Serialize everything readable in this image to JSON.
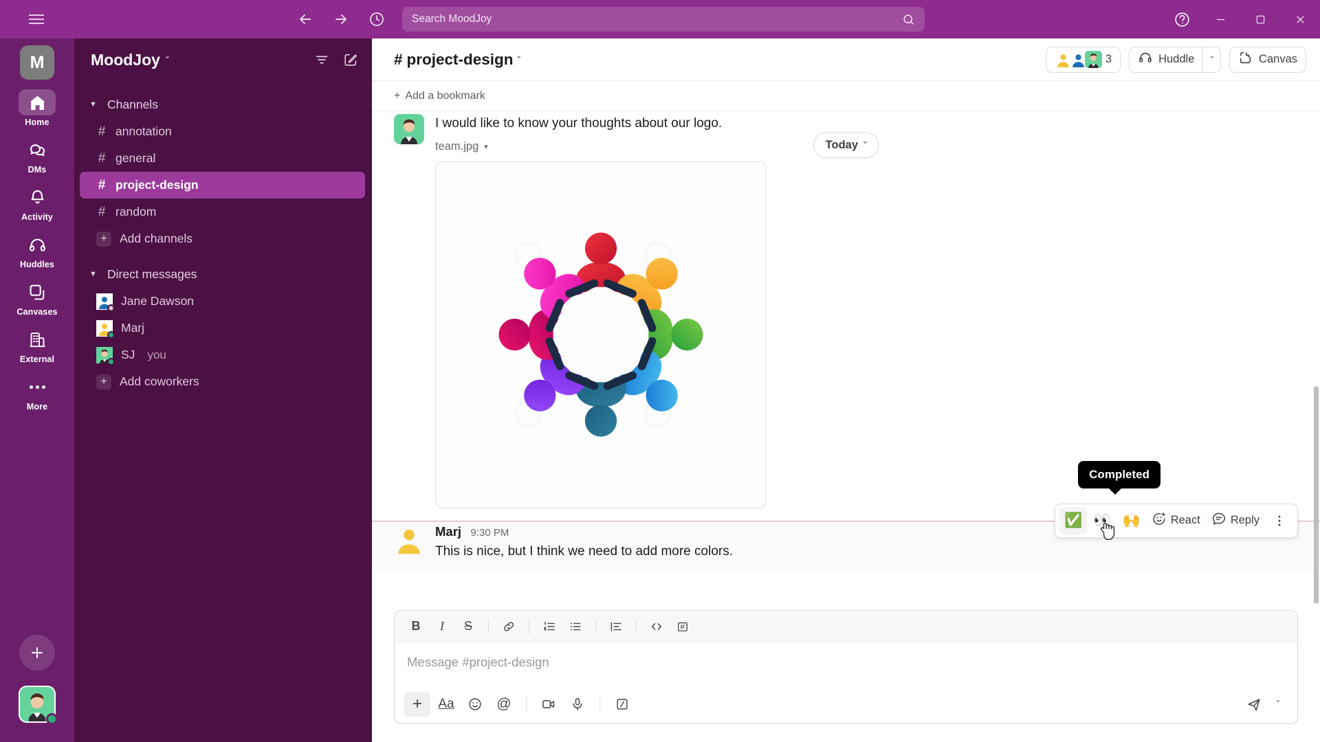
{
  "topbar": {
    "menu_icon": "hamburger-icon",
    "back_icon": "arrow-left-icon",
    "forward_icon": "arrow-right-icon",
    "history_icon": "clock-icon",
    "search_placeholder": "Search MoodJoy",
    "search_icon": "search-icon",
    "help_icon": "help-circle-icon",
    "minimize_label": "–",
    "maximize_label": "□",
    "close_label": "✕"
  },
  "rail": {
    "workspace_initial": "M",
    "items": [
      {
        "label": "Home",
        "icon": "home-icon",
        "active": true
      },
      {
        "label": "DMs",
        "icon": "dms-icon",
        "active": false
      },
      {
        "label": "Activity",
        "icon": "bell-icon",
        "active": false
      },
      {
        "label": "Huddles",
        "icon": "headphones-icon",
        "active": false
      },
      {
        "label": "Canvases",
        "icon": "canvas-icon",
        "active": false
      },
      {
        "label": "External",
        "icon": "building-icon",
        "active": false
      },
      {
        "label": "More",
        "icon": "ellipsis-icon",
        "active": false
      }
    ],
    "new_button_icon": "plus-icon",
    "avatar_name": "user-avatar"
  },
  "sidebar": {
    "workspace_name": "MoodJoy",
    "workspace_chevron": "ˇ",
    "filter_icon": "filter-icon",
    "compose_icon": "compose-icon",
    "channels_section": {
      "label": "Channels",
      "caret": "▼"
    },
    "channels": [
      {
        "label": "annotation",
        "prefix": "#",
        "active": false
      },
      {
        "label": "general",
        "prefix": "#",
        "active": false
      },
      {
        "label": "project-design",
        "prefix": "#",
        "active": true
      },
      {
        "label": "random",
        "prefix": "#",
        "active": false
      }
    ],
    "add_channels": {
      "label": "Add channels",
      "prefix": "+"
    },
    "dm_section": {
      "label": "Direct messages",
      "caret": "▼"
    },
    "dms": [
      {
        "label": "Jane Dawson",
        "presence": "away",
        "suffix": ""
      },
      {
        "label": "Marj",
        "presence": "online",
        "suffix": ""
      },
      {
        "label": "SJ",
        "presence": "online",
        "suffix": "you"
      }
    ],
    "add_coworkers": {
      "label": "Add coworkers",
      "prefix": "+"
    }
  },
  "channel": {
    "prefix": "#",
    "name": "project-design",
    "chevron": "ˇ",
    "member_count": "3",
    "huddle_label": "Huddle",
    "huddle_chevron": "ˇ",
    "canvas_label": "Canvas",
    "bookmark_label": "Add a bookmark",
    "bookmark_prefix": "+"
  },
  "today_chip": {
    "label": "Today",
    "chevron": "ˇ"
  },
  "messages": [
    {
      "author": "",
      "time": "",
      "text": "I would like to know your thoughts about our logo.",
      "attachment_name": "team.jpg",
      "attachment_chevron": "▾"
    },
    {
      "author": "Marj",
      "time": "9:30 PM",
      "text": "This is nice, but I think we need to add more colors."
    }
  ],
  "hover_toolbar": {
    "tooltip": "Completed",
    "reactions": [
      {
        "name": "white-check-mark-emoji",
        "glyph": "✅",
        "selected": true
      },
      {
        "name": "eyes-emoji",
        "glyph": "👀",
        "selected": false
      },
      {
        "name": "raised-hands-emoji",
        "glyph": "🙌",
        "selected": false
      }
    ],
    "react_label": "React",
    "react_icon": "add-reaction-icon",
    "reply_label": "Reply",
    "reply_icon": "reply-icon",
    "more_icon": "more-vertical-icon"
  },
  "composer": {
    "placeholder": "Message #project-design",
    "format_buttons": [
      {
        "name": "bold-button",
        "glyph": "B"
      },
      {
        "name": "italic-button",
        "glyph": "I"
      },
      {
        "name": "strikethrough-button",
        "glyph": "S"
      },
      {
        "name": "link-button",
        "glyph": "link-icon"
      },
      {
        "name": "ordered-list-button",
        "glyph": "ordered-list-icon"
      },
      {
        "name": "bulleted-list-button",
        "glyph": "bulleted-list-icon"
      },
      {
        "name": "blockquote-button",
        "glyph": "blockquote-icon"
      },
      {
        "name": "code-button",
        "glyph": "code-icon"
      },
      {
        "name": "code-block-button",
        "glyph": "code-block-icon"
      }
    ],
    "action_buttons": [
      {
        "name": "attach-button",
        "glyph": "+"
      },
      {
        "name": "formatting-button",
        "glyph": "Aa"
      },
      {
        "name": "emoji-button",
        "glyph": "emoji-icon"
      },
      {
        "name": "mention-button",
        "glyph": "@"
      },
      {
        "name": "video-button",
        "glyph": "video-icon"
      },
      {
        "name": "audio-button",
        "glyph": "mic-icon"
      },
      {
        "name": "slash-command-button",
        "glyph": "slash-icon"
      }
    ],
    "send_icon": "send-icon",
    "send_chevron": "ˇ"
  },
  "colors": {
    "brand_purple": "#4b1044",
    "topbar_purple": "#8e2b8e",
    "active_channel": "#9b3a9b",
    "accent_green": "#2bac76"
  }
}
